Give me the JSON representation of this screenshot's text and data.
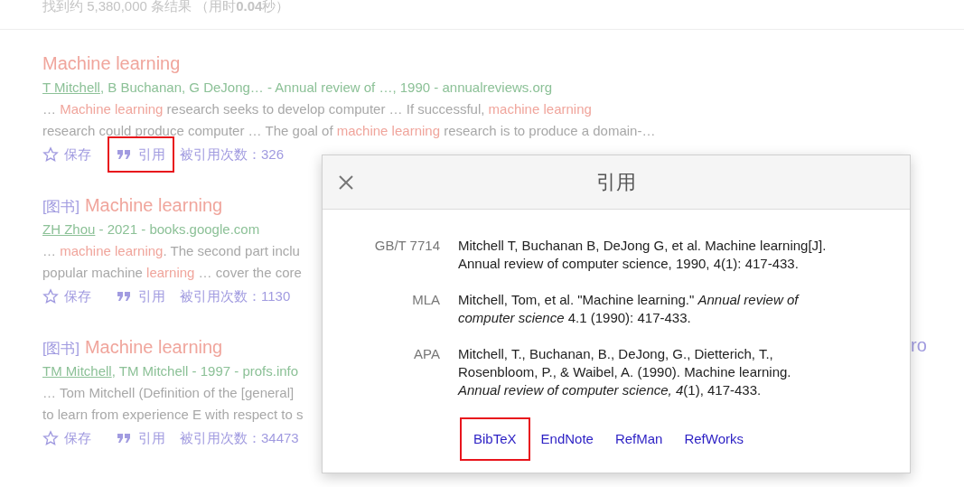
{
  "summary": "找到约 5,380,000 条结果 （用时**0.04**秒）",
  "results": [
    {
      "title": "Machine learning",
      "author_link": "T Mitchell",
      "byline": ", B Buchanan, G DeJong… - Annual review of …, 1990 - annualreviews.org",
      "snippet": [
        "… **Machine learning** research seeks to develop computer … If successful, **machine learning**",
        "research could produce computer … The goal of **machine learning** research is to produce a domain-…"
      ],
      "save": "保存",
      "cite": "引用",
      "cite_highlighted": true,
      "cited_by": "被引用次数：326"
    },
    {
      "tag": "[图书]",
      "title": "Machine learning",
      "author_link": "ZH Zhou",
      "byline": " - 2021 - books.google.com",
      "snippet": [
        "… **machine learning**. The second part inclu",
        "popular machine **learning** … cover the core"
      ],
      "save": "保存",
      "cite": "引用",
      "cite_highlighted": false,
      "cited_by": "被引用次数：1130"
    },
    {
      "tag": "[图书]",
      "title": "Machine learning",
      "author_link": "TM Mitchell",
      "byline": ", TM Mitchell - 1997 - profs.info",
      "snippet": [
        "… Tom Mitchell (Definition of the [general]",
        "to learn from experience E with respect to s"
      ],
      "save": "保存",
      "cite": "引用",
      "cite_highlighted": false,
      "cited_by": "被引用次数：34473",
      "side_link": "ro"
    }
  ],
  "dialog": {
    "title": "引用",
    "citations": [
      {
        "style": "GB/T 7714",
        "text": "Mitchell T, Buchanan B, DeJong G, et al. Machine learning[J]. Annual review of computer science, 1990, 4(1): 417-433."
      },
      {
        "style": "MLA",
        "text": "Mitchell, Tom, et al. \"Machine learning.\" *Annual review of computer science* 4.1 (1990): 417-433."
      },
      {
        "style": "APA",
        "text": "Mitchell, T., Buchanan, B., DeJong, G., Dietterich, T., Rosenbloom, P., & Waibel, A. (1990). Machine learning. *Annual review of computer science, 4*(1), 417-433."
      }
    ],
    "exports": [
      {
        "label": "BibTeX",
        "highlighted": true
      },
      {
        "label": "EndNote",
        "highlighted": false
      },
      {
        "label": "RefMan",
        "highlighted": false
      },
      {
        "label": "RefWorks",
        "highlighted": false
      }
    ]
  }
}
